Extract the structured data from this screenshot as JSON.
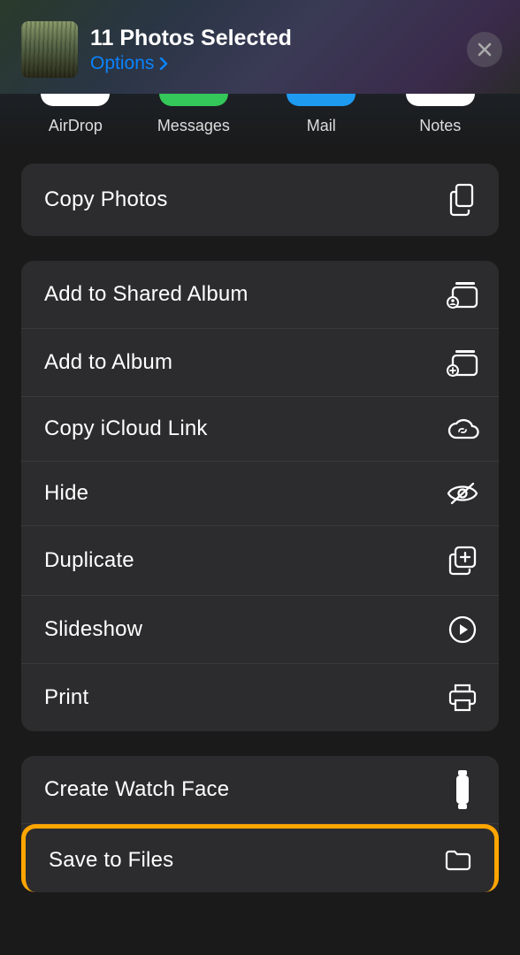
{
  "header": {
    "title": "11 Photos Selected",
    "options_label": "Options"
  },
  "apps": [
    {
      "label": "AirDrop"
    },
    {
      "label": "Messages"
    },
    {
      "label": "Mail"
    },
    {
      "label": "Notes"
    }
  ],
  "sections": [
    {
      "rows": [
        {
          "id": "copy-photos",
          "label": "Copy Photos"
        }
      ]
    },
    {
      "rows": [
        {
          "id": "add-shared-album",
          "label": "Add to Shared Album"
        },
        {
          "id": "add-album",
          "label": "Add to Album"
        },
        {
          "id": "copy-icloud",
          "label": "Copy iCloud Link"
        },
        {
          "id": "hide",
          "label": "Hide"
        },
        {
          "id": "duplicate",
          "label": "Duplicate"
        },
        {
          "id": "slideshow",
          "label": "Slideshow"
        },
        {
          "id": "print",
          "label": "Print"
        }
      ]
    },
    {
      "rows": [
        {
          "id": "watch-face",
          "label": "Create Watch Face"
        },
        {
          "id": "save-files",
          "label": "Save to Files"
        }
      ]
    }
  ]
}
